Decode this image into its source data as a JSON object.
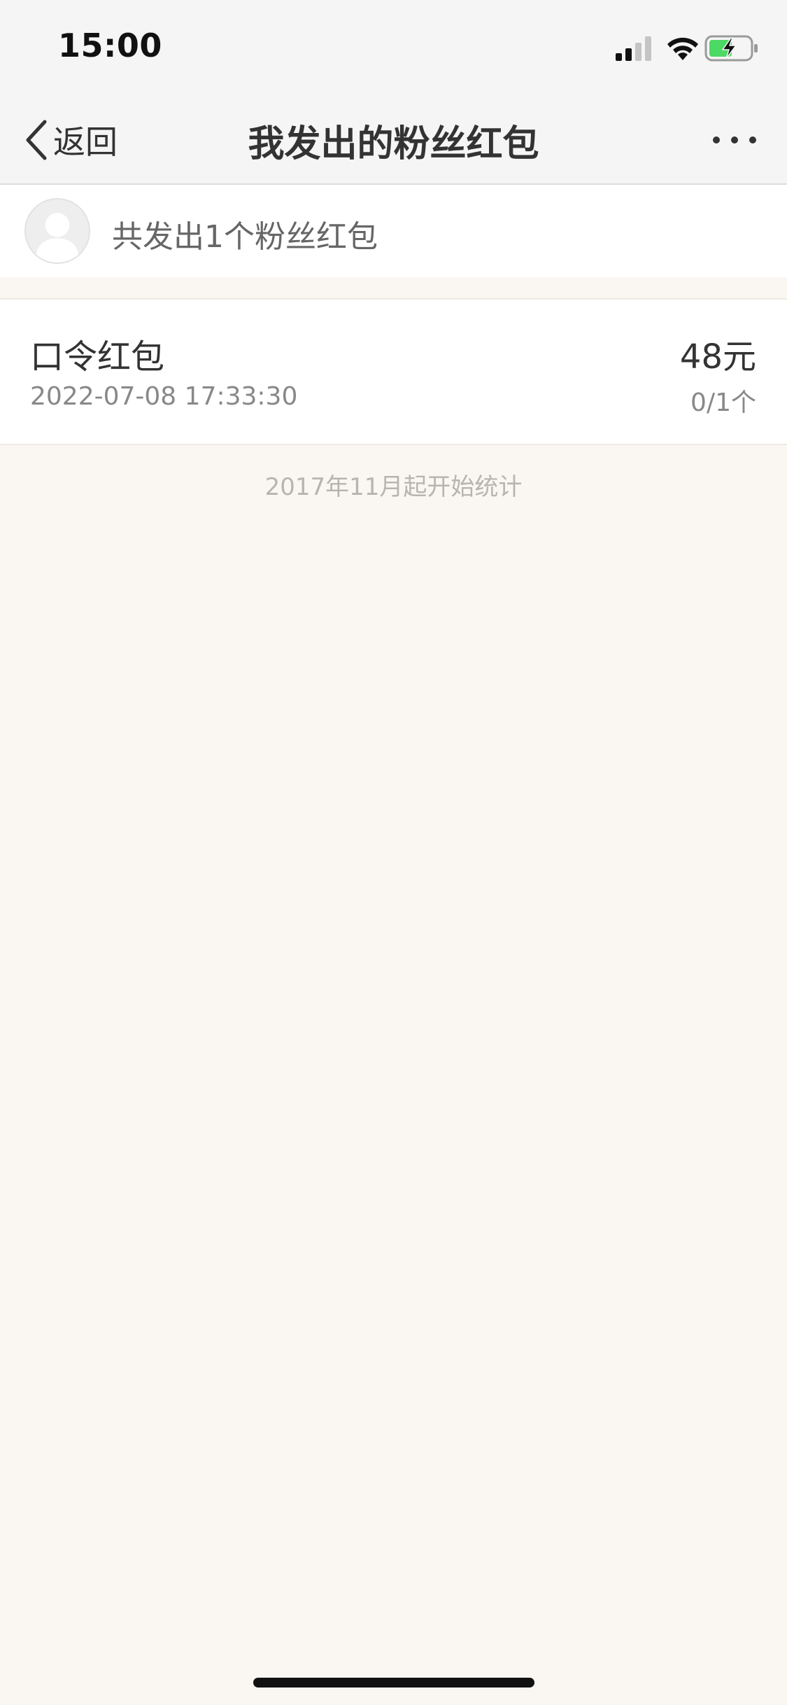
{
  "status_bar": {
    "time": "15:00",
    "icons": [
      "signal-icon",
      "wifi-icon",
      "battery-charging-icon"
    ],
    "battery_color": "#4cd964"
  },
  "nav": {
    "back_label": "返回",
    "title": "我发出的粉丝红包",
    "more_icon": "more-dots-icon"
  },
  "summary": {
    "text": "共发出1个粉丝红包",
    "avatar_icon": "default-avatar-icon"
  },
  "records": [
    {
      "type": "口令红包",
      "time": "2022-07-08 17:33:30",
      "amount": "48元",
      "count": "0/1个"
    }
  ],
  "footer_note": "2017年11月起开始统计",
  "colors": {
    "page_background": "#faf6f1",
    "bar_background": "#f5f5f5",
    "primary_text": "#333333",
    "secondary_text": "#888888"
  }
}
